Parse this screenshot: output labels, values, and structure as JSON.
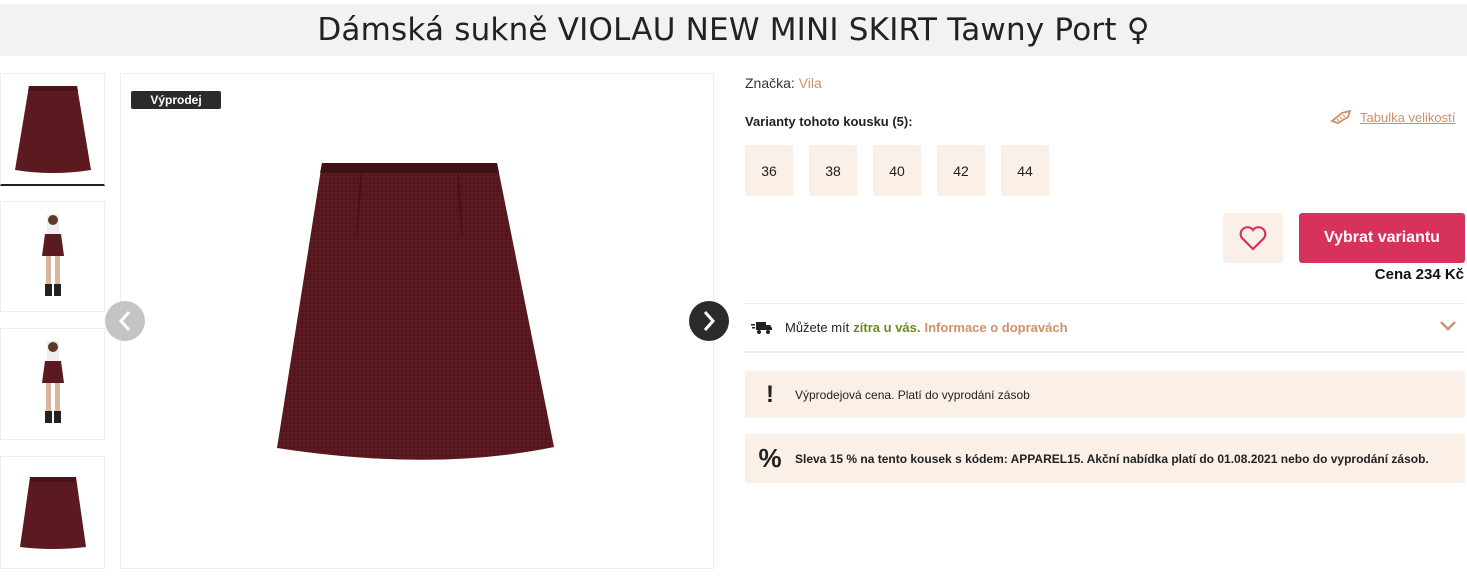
{
  "product": {
    "title": "Dámská sukně VIOLAU NEW MINI SKIRT Tawny Port ♀",
    "badge": "Výprodej"
  },
  "brand": {
    "label": "Značka:",
    "value": "Vila"
  },
  "variants": {
    "label": "Varianty tohoto kousku (5):",
    "sizes": [
      "36",
      "38",
      "40",
      "42",
      "44"
    ],
    "size_table_link": "Tabulka velikostí"
  },
  "actions": {
    "buy_label": "Vybrat variantu",
    "price": "Cena 234 Kč"
  },
  "delivery": {
    "text": "Můžete mít",
    "highlight": "zítra u vás.",
    "link": "Informace o dopravách"
  },
  "notices": [
    {
      "icon": "!",
      "text": "Výprodejová cena. Platí do vyprodání zásob"
    },
    {
      "icon": "%",
      "text": "Sleva 15 % na tento kousek s kódem: APPAREL15. Akční nabídka platí do 01.08.2021 nebo do vyprodání zásob."
    }
  ],
  "colors": {
    "accent": "#d6325c",
    "beige": "#fbf0e7",
    "link": "#d09068",
    "skirt": "#5a1a1f"
  }
}
